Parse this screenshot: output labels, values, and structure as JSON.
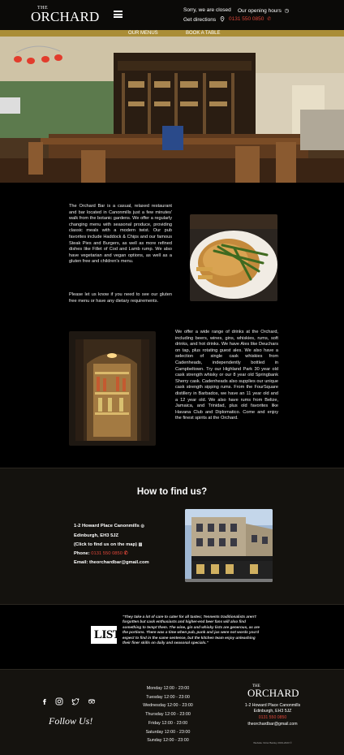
{
  "header": {
    "logo_small": "THE",
    "logo_main": "ORCHARD",
    "closed_text": "Sorry, we are closed",
    "hours_text": "Our opening hours",
    "directions_text": "Get directions",
    "phone": "0131 550 0850"
  },
  "nav": {
    "menus": "OUR MENUS",
    "book": "BOOK A TABLE"
  },
  "intro": {
    "para1": "The Orchard Bar is a casual, relaxed restaurant and bar located in Canonmills just a few minutes' walk from the botanic gardens. We offer a regularly changing menu with seasonal produce, providing classic meals with a modern twist. Our pub favorites include Haddock & Chips and our famous Steak Pies and Burgers, as well as more refined dishes like Fillet of Cod and Lamb rump. We also have vegetarian and vegan options, as well as a gluten free and children's menu.",
    "para2": "Please let us know if you need to see our gluten free menu or have any dietary requirements.",
    "para3": "We offer a wide range of drinks at the Orchard, including beers, wines, gins, whiskies, rums, soft drinks, and hot drinks. We have Ales like Deuchars on tap, plus rotating guest ales. We also have a selection of single cask whiskies from Cadenheads, independently bottled in Campbeltown. Try our Highland Park 30 year old cask strength whisky or our 8 year old Springbank Sherry cask. Cadenheads also supplies our unique cask strength sipping rums. From the FourSquare distillery in Barbados, we have an 11 year old and a 12 year old. We also have rums from Belize, Jamaica, and Trinidad, plus old favorites like Havana Club and Diplomatico. Come and enjoy the finest spirits at the Orchard."
  },
  "find": {
    "title": "How to find us?",
    "address1": "1-2 Howard Place Canonmills",
    "address2": "Edinburgh, EH3 5JZ",
    "map_link": "(Click to find us on the map)",
    "phone_label": "Phone:",
    "phone": "0131 550 0850",
    "email_label": "Email:",
    "email": "theorchardbar@gmail.com"
  },
  "review": {
    "logo": "LIST",
    "quote": "\"They take a lot of care to cater for all tastes; Tennents traditionalists aren't forgotten but cask enthusiasts and higher-end beer fans will also find something to tempt them. The wine, gin and whisky lists are generous, as are the portions. There was a time when pub, punk and jus were not words you'd expect to find in the same sentence, but the kitchen team enjoy unleashing their finer skills on daily and seasonal specials.\""
  },
  "footer": {
    "follow": "Follow Us!",
    "days": [
      "Monday 12:00 - 23:00",
      "Tuesday 12:00 - 23:00",
      "Wednesday 12:00 - 23:00",
      "Thursday 12:00 - 23:00",
      "Friday 12:00 - 23:00",
      "Saturday 12:00 - 23:00",
      "Sunday 12:00 - 23:00"
    ],
    "logo_small": "THE",
    "logo_main": "ORCHARD",
    "address1": "1-2 Howard Place Canonmills",
    "address2": "Edinburgh, EH3 5JZ",
    "phone": "0131 550 0850",
    "email": "theorchardbar@gmail.com",
    "copyright": "Website Victor Barsky 2019-2023 ©"
  },
  "colors": {
    "accent_gold": "#aa8d36",
    "phone_red": "#e0473a"
  },
  "icons": [
    "menu-icon",
    "clock-icon",
    "location-pin-icon",
    "phone-icon",
    "facebook-icon",
    "instagram-icon",
    "twitter-icon",
    "tripadvisor-icon"
  ]
}
